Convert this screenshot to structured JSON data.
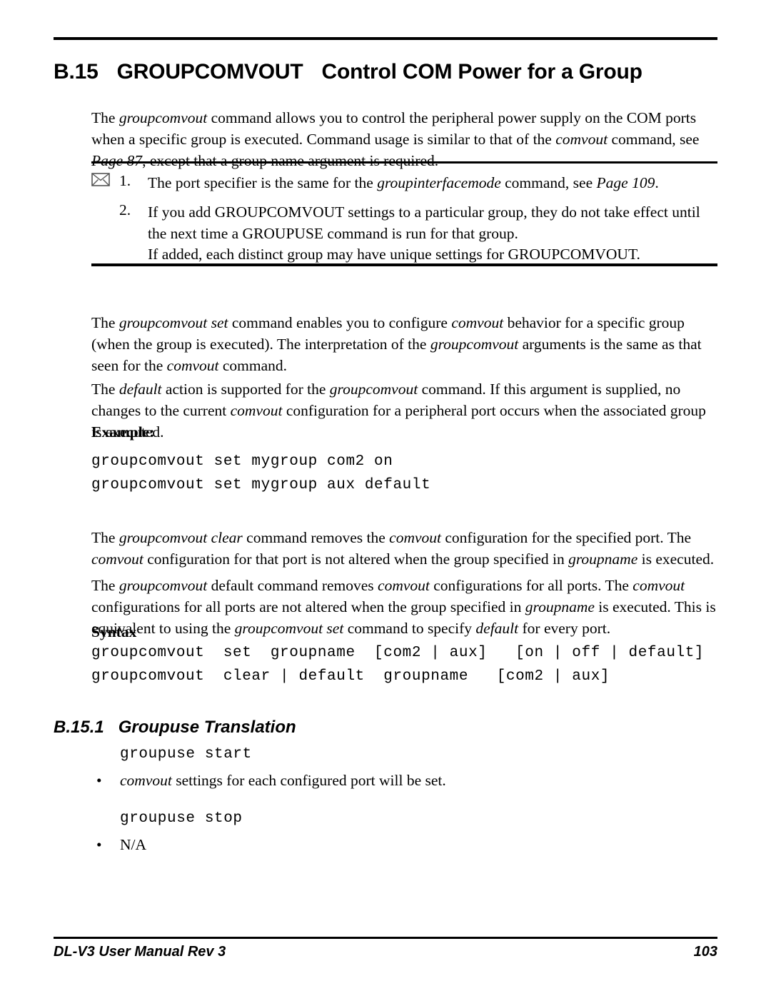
{
  "page": {
    "number": "103",
    "footer_left": "DL-V3 User Manual Rev 3"
  },
  "heading": {
    "section_number": "B.15",
    "command_name": "GROUPCOMVOUT",
    "description": "Control COM Power for a Group"
  },
  "intro_paragraph": {
    "line1_a": "The ",
    "line1_i": "groupcomvout",
    "line1_b": " command allows you to control the peripheral power supply on the COM ports when a specific group is executed. Command usage is similar to that of the ",
    "line1_i2": "comvout",
    "line1_c": " command, see ",
    "line1_i3": "Page 87",
    "line1_d": ", except that a group name argument is required."
  },
  "note_box": {
    "icon": "envelope-icon",
    "items": [
      {
        "number": "1.",
        "text_a": "The port specifier is the same for the ",
        "text_i": "groupinterfacemode",
        "text_b": " command, see ",
        "text_i2": "Page 109",
        "text_c": "."
      },
      {
        "number": "2.",
        "text_a": "If you add GROUPCOMVOUT settings to a particular group, they do not take effect until the next time a GROUPUSE command is run for that group.",
        "text_i": "",
        "text_b": "",
        "text_i2": "",
        "text_c": ""
      }
    ],
    "continuation": "If added, each distinct group may have unique settings for GROUPCOMVOUT."
  },
  "body": {
    "para_set": {
      "a": "The ",
      "i1": "groupcomvout set",
      "b": " command enables you to configure ",
      "i2": "comvout",
      "c": " behavior for a specific group (when the group is executed). The interpretation of the ",
      "i3": "groupcomvout",
      "d": " arguments is the same as that seen for the ",
      "i4": "comvout",
      "e": " command."
    },
    "para_default": {
      "a": "The ",
      "i1": "default",
      "b": " action is supported for the ",
      "i2": "groupcomvout",
      "c": " command. If this argument is supplied, no changes to the current ",
      "i3": "comvout",
      "d": " configuration for a peripheral port occurs when the associated group is executed."
    },
    "para_clear": {
      "a": "The ",
      "i1": "groupcomvout clear",
      "b": " command removes the ",
      "i2": "comvout",
      "c": " configuration for the specified port. The ",
      "i3": "comvout",
      "d": " configuration for that port is not altered when the group specified in ",
      "i4": "groupname",
      "e": " is executed."
    },
    "para_default2": {
      "a": "The ",
      "i1": "groupcomvout",
      "b": " default command removes ",
      "i2": "comvout",
      "c": " configurations for all ports. The ",
      "i3": "comvout",
      "d": " configurations for all ports are not altered when the group specified in ",
      "i4": "groupname",
      "e": " is executed. This is equivalent to using the ",
      "i5": "groupcomvout set",
      "f": " command to specify ",
      "i6": "default",
      "g": " for every port."
    }
  },
  "example": {
    "label": "Example:",
    "lines": [
      "groupcomvout set mygroup com2 on",
      "groupcomvout set mygroup aux default"
    ]
  },
  "syntax": {
    "label": "Syntax",
    "lines": [
      "groupcomvout  set  groupname  [com2 | aux]   [on | off | default]",
      "groupcomvout  clear | default  groupname   [com2 | aux]"
    ]
  },
  "subsection": {
    "number": "B.15.1",
    "title": "Groupuse Translation",
    "blocks": [
      {
        "code": "groupuse start",
        "bullet_char": "•",
        "bullet_i": "comvout",
        "bullet_text": " settings for each configured port will be set."
      },
      {
        "code": "groupuse stop",
        "bullet_char": "•",
        "bullet_i": "",
        "bullet_text": "N/A"
      }
    ]
  }
}
